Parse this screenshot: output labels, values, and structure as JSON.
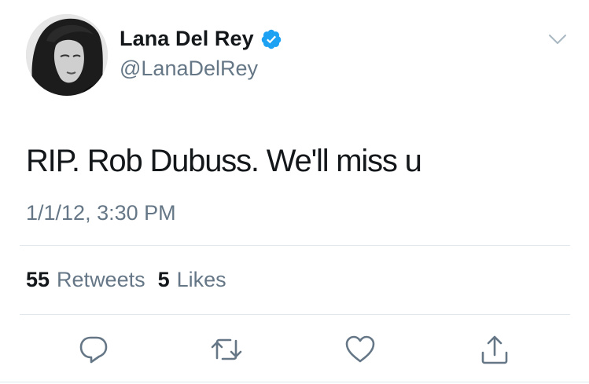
{
  "author": {
    "display_name": "Lana Del Rey",
    "handle": "@LanaDelRey",
    "verified": true,
    "avatar_icon": "avatar-photo"
  },
  "tweet": {
    "text": "RIP. Rob Dubuss. We'll miss u",
    "timestamp": "1/1/12, 3:30 PM"
  },
  "stats": {
    "retweets_count": "55",
    "retweets_label": "Retweets",
    "likes_count": "5",
    "likes_label": "Likes"
  },
  "actions": {
    "reply_icon": "reply-icon",
    "retweet_icon": "retweet-icon",
    "like_icon": "heart-icon",
    "share_icon": "share-icon"
  },
  "colors": {
    "text": "#14171a",
    "secondary": "#657786",
    "verified": "#1da1f2",
    "divider": "#e1e8ed",
    "action_icon": "#657786"
  }
}
